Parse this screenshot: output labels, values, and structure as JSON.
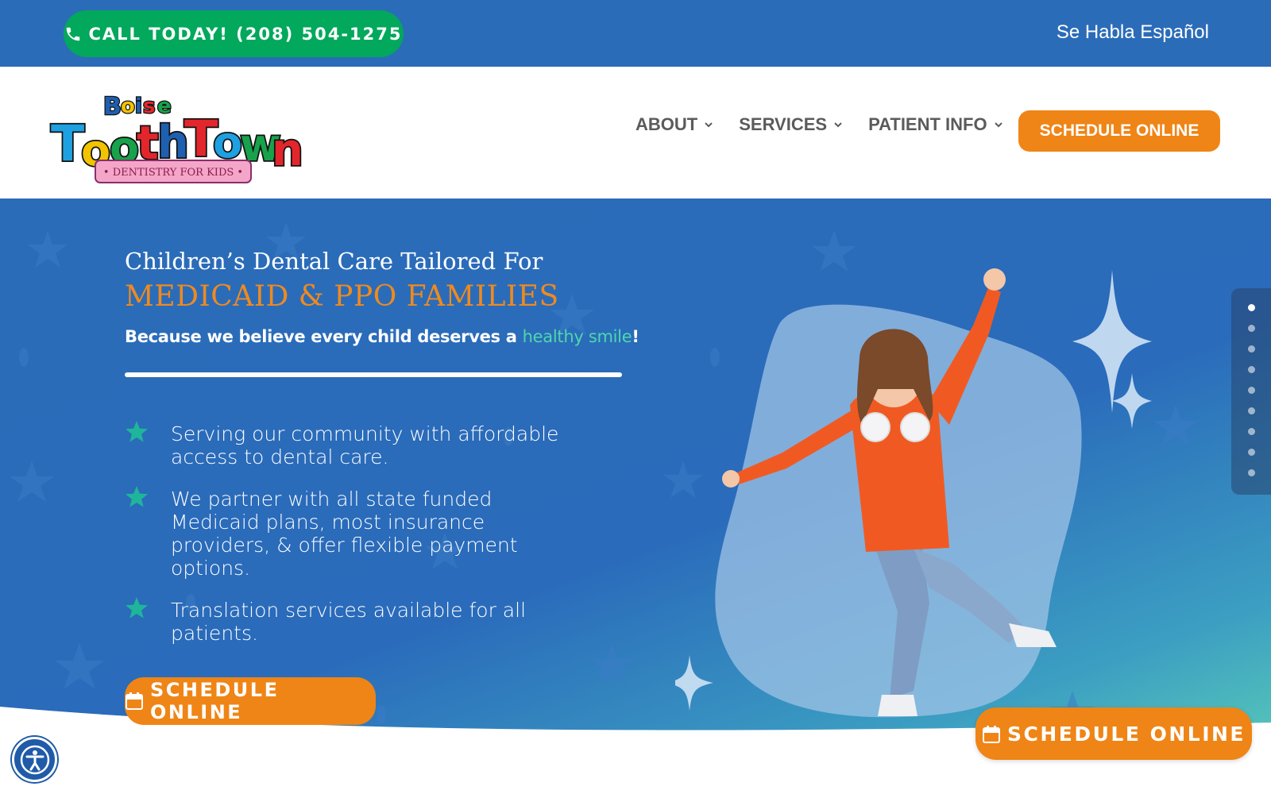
{
  "topbar": {
    "call_label": "CALL TODAY! (208) 504-1275",
    "spanish_label": "Se Habla Español"
  },
  "header": {
    "logo_text": "Boise ToothTown Dentistry for Kids",
    "nav": [
      {
        "label": "ABOUT"
      },
      {
        "label": "SERVICES"
      },
      {
        "label": "PATIENT INFO"
      }
    ],
    "cta_label": "SCHEDULE ONLINE"
  },
  "hero": {
    "title": "Children’s Dental Care Tailored For",
    "subtitle": "MEDICAID & PPO FAMILIES",
    "tagline_prefix": "Because we believe every child deserves a ",
    "tagline_highlight": "healthy smile",
    "tagline_suffix": "!",
    "bullets": [
      "Serving our community with affordable access to dental care.",
      "We partner with all state funded Medicaid plans, most insurance providers, & offer flexible payment options.",
      "Translation services available for all patients."
    ],
    "cta_label": "SCHEDULE ONLINE"
  },
  "slider": {
    "count": 9,
    "active": 0
  },
  "floating_cta_label": "SCHEDULE ONLINE",
  "colors": {
    "brand_blue": "#2b6cb8",
    "call_green": "#02a85c",
    "orange": "#ef8516",
    "teal": "#4fd6ad"
  }
}
